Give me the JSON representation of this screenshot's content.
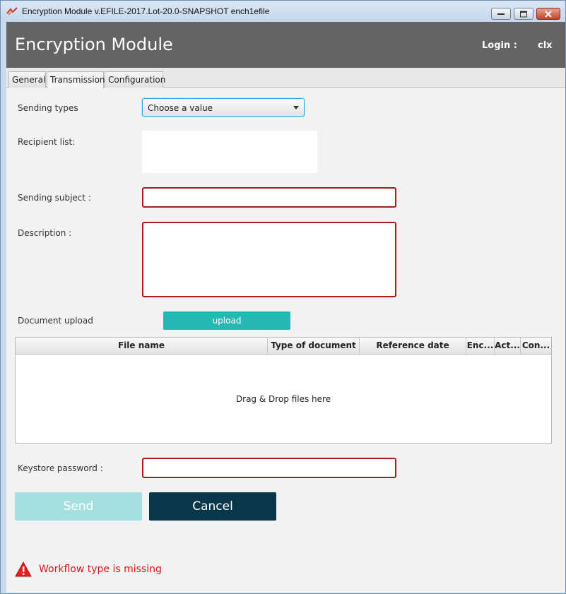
{
  "window": {
    "title": "Encryption Module v.EFILE-2017.Lot-20.0-SNAPSHOT ench1efile"
  },
  "header": {
    "app_title": "Encryption Module",
    "login_label": "Login :",
    "login_user": "clx"
  },
  "tabs": [
    {
      "label": "General",
      "active": false
    },
    {
      "label": "Transmission",
      "active": true
    },
    {
      "label": "Configuration",
      "active": false
    }
  ],
  "form": {
    "sending_types_label": "Sending types",
    "sending_types_value": "Choose a value",
    "recipient_label": "Recipient list:",
    "subject_label": "Sending subject :",
    "subject_value": "",
    "description_label": "Description :",
    "description_value": "",
    "upload_label": "Document upload",
    "upload_button": "upload",
    "keystore_label": "Keystore password :",
    "keystore_value": ""
  },
  "table": {
    "columns": [
      "File name",
      "Type of document",
      "Reference date",
      "Enc...",
      "Act...",
      "Con..."
    ],
    "placeholder": "Drag & Drop files here"
  },
  "actions": {
    "send": "Send",
    "cancel": "Cancel"
  },
  "status": {
    "message": "Workflow type is missing"
  },
  "colors": {
    "header_bg": "#646464",
    "accent": "#26b8b3",
    "error": "#d81616",
    "cancel_bg": "#073749"
  }
}
